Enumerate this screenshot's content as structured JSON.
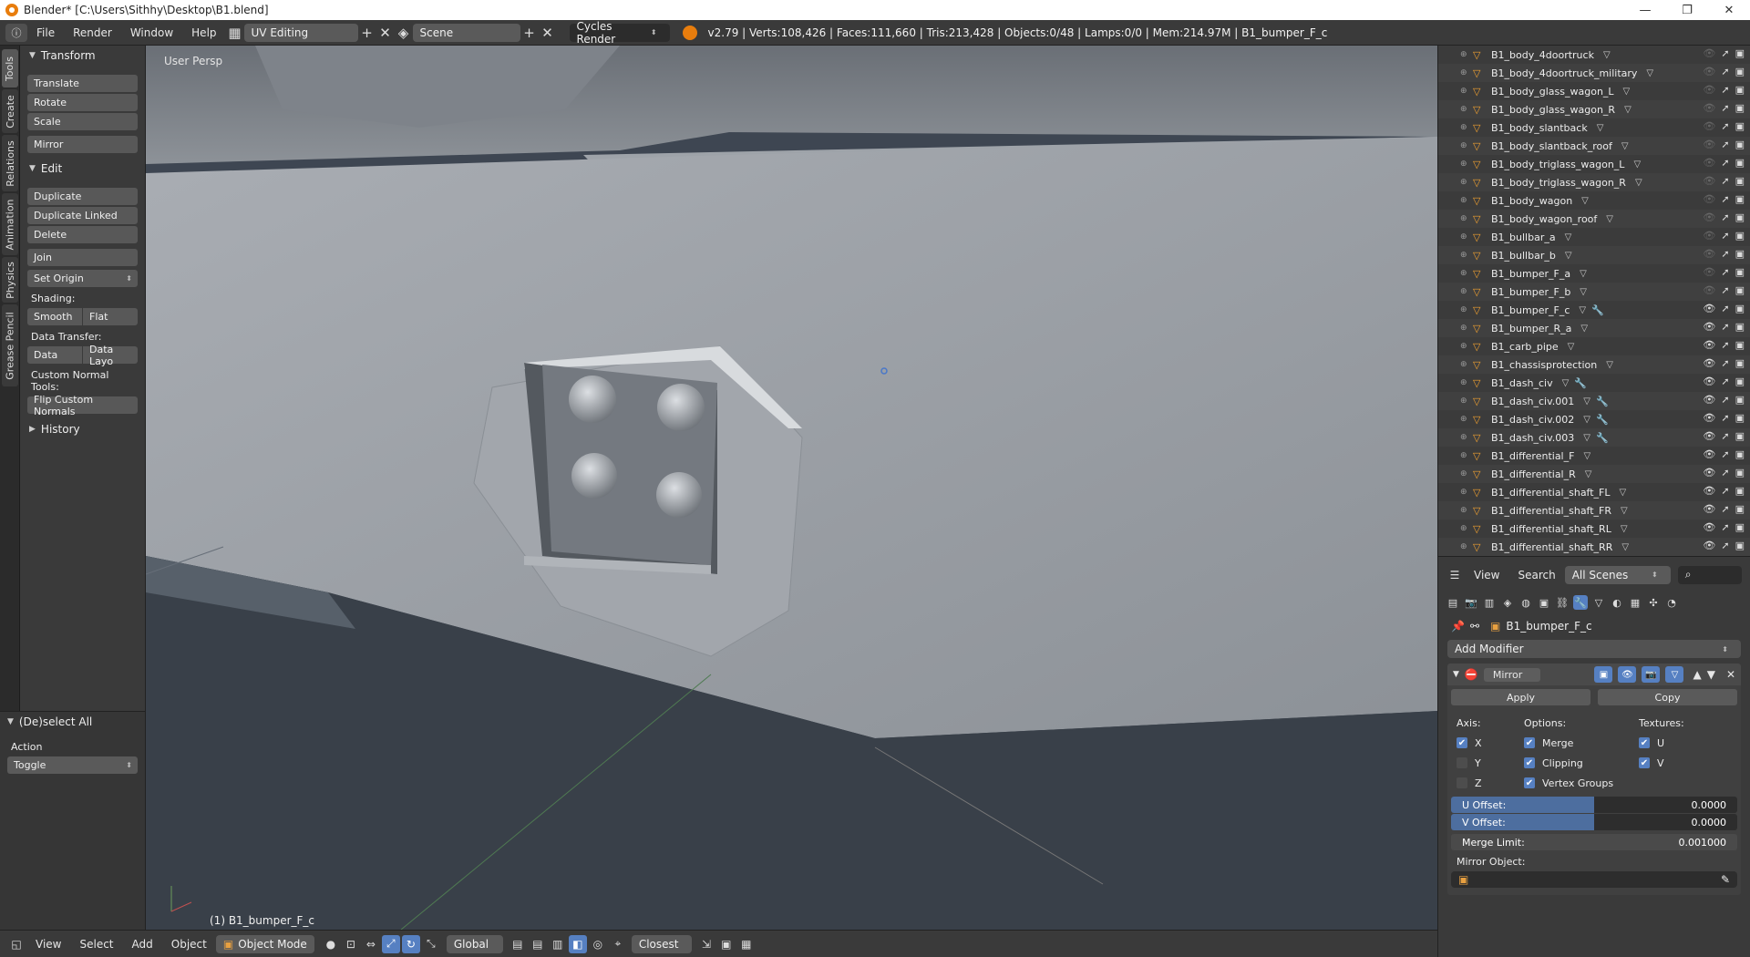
{
  "window": {
    "title": "Blender* [C:\\Users\\Sithhy\\Desktop\\B1.blend]"
  },
  "info_header": {
    "menus": [
      "File",
      "Render",
      "Window",
      "Help"
    ],
    "screen_layout": "UV Editing",
    "scene": "Scene",
    "render_engine": "Cycles Render",
    "stats": "v2.79 | Verts:108,426 | Faces:111,660 | Tris:213,428 | Objects:0/48 | Lamps:0/0 | Mem:214.97M | B1_bumper_F_c"
  },
  "left_tabs": [
    "Tools",
    "Create",
    "Relations",
    "Animation",
    "Physics",
    "Grease Pencil"
  ],
  "toolshelf": {
    "transform_title": "Transform",
    "transform_buttons": [
      "Translate",
      "Rotate",
      "Scale"
    ],
    "mirror": "Mirror",
    "edit_title": "Edit",
    "edit_buttons": [
      "Duplicate",
      "Duplicate Linked",
      "Delete"
    ],
    "join": "Join",
    "set_origin": "Set Origin",
    "shading_label": "Shading:",
    "smooth": "Smooth",
    "flat": "Flat",
    "data_transfer_label": "Data Transfer:",
    "data": "Data",
    "data_layout": "Data Layo",
    "custom_normal_label": "Custom Normal Tools:",
    "flip_normals": "Flip Custom Normals",
    "history": "History"
  },
  "operator_panel": {
    "title": "(De)select All",
    "action_label": "Action",
    "action_value": "Toggle"
  },
  "viewport": {
    "view_label": "User Persp",
    "object_label": "(1) B1_bumper_F_c"
  },
  "view3d_header": {
    "menus": [
      "View",
      "Select",
      "Add",
      "Object"
    ],
    "mode": "Object Mode",
    "orientation": "Global",
    "snap": "Closest"
  },
  "outliner": {
    "rows": [
      {
        "name": "B1_body_4doortruck",
        "mods": false,
        "visible": false
      },
      {
        "name": "B1_body_4doortruck_military",
        "mods": false,
        "visible": false
      },
      {
        "name": "B1_body_glass_wagon_L",
        "mods": false,
        "visible": false
      },
      {
        "name": "B1_body_glass_wagon_R",
        "mods": false,
        "visible": false
      },
      {
        "name": "B1_body_slantback",
        "mods": false,
        "visible": false
      },
      {
        "name": "B1_body_slantback_roof",
        "mods": false,
        "visible": false
      },
      {
        "name": "B1_body_triglass_wagon_L",
        "mods": false,
        "visible": false
      },
      {
        "name": "B1_body_triglass_wagon_R",
        "mods": false,
        "visible": false
      },
      {
        "name": "B1_body_wagon",
        "mods": false,
        "visible": false
      },
      {
        "name": "B1_body_wagon_roof",
        "mods": false,
        "visible": false
      },
      {
        "name": "B1_bullbar_a",
        "mods": false,
        "visible": false
      },
      {
        "name": "B1_bullbar_b",
        "mods": false,
        "visible": false
      },
      {
        "name": "B1_bumper_F_a",
        "mods": false,
        "visible": false
      },
      {
        "name": "B1_bumper_F_b",
        "mods": false,
        "visible": false
      },
      {
        "name": "B1_bumper_F_c",
        "mods": true,
        "visible": true
      },
      {
        "name": "B1_bumper_R_a",
        "mods": false,
        "visible": true
      },
      {
        "name": "B1_carb_pipe",
        "mods": false,
        "visible": true
      },
      {
        "name": "B1_chassisprotection",
        "mods": false,
        "visible": true
      },
      {
        "name": "B1_dash_civ",
        "mods": true,
        "visible": true
      },
      {
        "name": "B1_dash_civ.001",
        "mods": true,
        "visible": true
      },
      {
        "name": "B1_dash_civ.002",
        "mods": true,
        "visible": true
      },
      {
        "name": "B1_dash_civ.003",
        "mods": true,
        "visible": true
      },
      {
        "name": "B1_differential_F",
        "mods": false,
        "visible": true
      },
      {
        "name": "B1_differential_R",
        "mods": false,
        "visible": true
      },
      {
        "name": "B1_differential_shaft_FL",
        "mods": false,
        "visible": true
      },
      {
        "name": "B1_differential_shaft_FR",
        "mods": false,
        "visible": true
      },
      {
        "name": "B1_differential_shaft_RL",
        "mods": false,
        "visible": true
      },
      {
        "name": "B1_differential_shaft_RR",
        "mods": false,
        "visible": true
      }
    ],
    "footer_menus": [
      "View",
      "Search"
    ],
    "filter": "All Scenes"
  },
  "properties": {
    "context_object": "B1_bumper_F_c",
    "add_modifier": "Add Modifier",
    "modifier_name": "Mirror",
    "apply": "Apply",
    "copy": "Copy",
    "axis_label": "Axis:",
    "options_label": "Options:",
    "textures_label": "Textures:",
    "axis": [
      {
        "label": "X",
        "on": true
      },
      {
        "label": "Y",
        "on": false
      },
      {
        "label": "Z",
        "on": false
      }
    ],
    "options": [
      {
        "label": "Merge",
        "on": true
      },
      {
        "label": "Clipping",
        "on": true
      },
      {
        "label": "Vertex Groups",
        "on": true
      }
    ],
    "textures": [
      {
        "label": "U",
        "on": true
      },
      {
        "label": "V",
        "on": true
      }
    ],
    "u_offset_label": "U Offset:",
    "u_offset_value": "0.0000",
    "v_offset_label": "V Offset:",
    "v_offset_value": "0.0000",
    "merge_limit_label": "Merge Limit:",
    "merge_limit_value": "0.001000",
    "mirror_object_label": "Mirror Object:"
  }
}
